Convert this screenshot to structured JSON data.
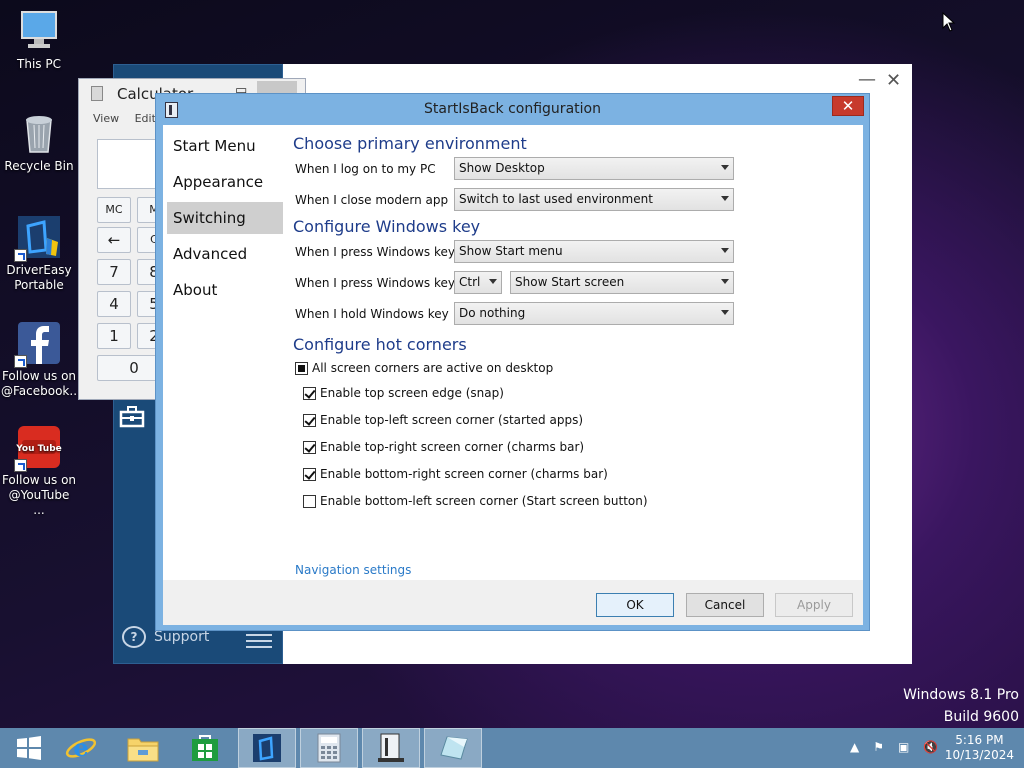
{
  "desktop": {
    "icons": [
      {
        "label": "This PC"
      },
      {
        "label": "Recycle Bin"
      },
      {
        "label": "DriverEasy Portable"
      },
      {
        "label": "Follow us on @Facebook..."
      },
      {
        "label": "Follow us on @YouTube ..."
      }
    ],
    "youtube_logo_text": "You Tube"
  },
  "calculator": {
    "title": "Calculator",
    "menu": [
      "View",
      "Edit"
    ],
    "buttons": [
      "MC",
      "M",
      "←",
      "C",
      "7",
      "8",
      "4",
      "5",
      "1",
      "2",
      "0"
    ]
  },
  "start_panel": {
    "support_label": "Support"
  },
  "dialog": {
    "title": "StartIsBack configuration",
    "close_label": "✕",
    "nav": [
      "Start Menu",
      "Appearance",
      "Switching",
      "Advanced",
      "About"
    ],
    "selected_nav": "Switching",
    "sections": {
      "primary": {
        "heading": "Choose primary environment",
        "rows": [
          {
            "label": "When I log on to my PC",
            "value": "Show Desktop"
          },
          {
            "label": "When I close modern app",
            "value": "Switch to last used environment"
          }
        ]
      },
      "winkey": {
        "heading": "Configure Windows key",
        "rows": [
          {
            "label": "When I press Windows key",
            "value": "Show Start menu"
          },
          {
            "label": "When I press Windows key +",
            "modifier": "Ctrl",
            "value": "Show Start screen"
          },
          {
            "label": "When I hold Windows key",
            "value": "Do nothing"
          }
        ]
      },
      "corners": {
        "heading": "Configure hot corners",
        "master": {
          "label": "All screen corners are active on desktop",
          "state": "partial"
        },
        "items": [
          {
            "label": "Enable top screen edge (snap)",
            "checked": true
          },
          {
            "label": "Enable top-left screen corner (started apps)",
            "checked": true
          },
          {
            "label": "Enable top-right screen corner (charms bar)",
            "checked": true
          },
          {
            "label": "Enable bottom-right screen corner (charms bar)",
            "checked": true
          },
          {
            "label": "Enable bottom-left screen corner (Start screen button)",
            "checked": false
          }
        ]
      }
    },
    "nav_settings_link": "Navigation settings",
    "buttons": {
      "ok": "OK",
      "cancel": "Cancel",
      "apply": "Apply"
    }
  },
  "watermark": {
    "line1": "Windows 8.1 Pro",
    "line2": "Build 9600"
  },
  "taskbar": {
    "items": [
      "start-icon",
      "internet-explorer-icon",
      "file-explorer-icon",
      "store-icon",
      "drivereasy-icon",
      "calculator-icon",
      "startisback-icon",
      "display-icon"
    ],
    "clock_time": "5:16 PM",
    "clock_date": "10/13/2024"
  },
  "colors": {
    "accent": "#7cb2e2",
    "taskbar": "#5e88ad",
    "close": "#c73a2c",
    "link": "#2a7ac8",
    "heading": "#1e3c8a"
  }
}
